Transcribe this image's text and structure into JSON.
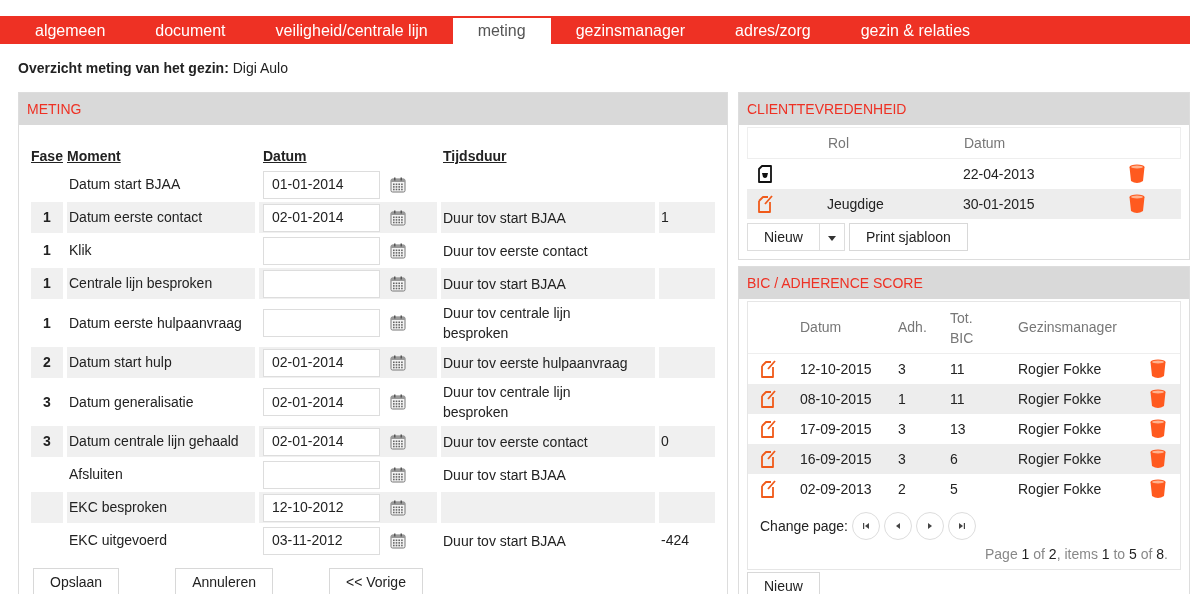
{
  "tabs": [
    {
      "label": "algemeen",
      "selected": false
    },
    {
      "label": "document",
      "selected": false
    },
    {
      "label": "veiligheid/centrale lijn",
      "selected": false
    },
    {
      "label": "meting",
      "selected": true
    },
    {
      "label": "gezinsmanager",
      "selected": false
    },
    {
      "label": "adres/zorg",
      "selected": false
    },
    {
      "label": "gezin & relaties",
      "selected": false
    }
  ],
  "heading": "**Overzicht meting van het gezin:** Digi Aulo",
  "meting": {
    "title": "METING",
    "columns": [
      "Fase",
      "Moment",
      "Datum",
      "Tijdsduur"
    ],
    "rows": [
      {
        "moment": "Datum start BJAA",
        "datum": "01-01-2014"
      },
      {
        "fase": "1",
        "moment": "Datum eerste contact",
        "datum": "02-01-2014",
        "tijdsduur": "Duur tov start BJAA",
        "waarde": "1"
      },
      {
        "fase": "1",
        "moment": "Klik",
        "tijdsduur": "Duur tov eerste contact"
      },
      {
        "fase": "1",
        "moment": "Centrale lijn besproken",
        "tijdsduur": "Duur tov start BJAA"
      },
      {
        "fase": "1",
        "moment": "Datum eerste hulpaanvraag",
        "tijdsduur": "Duur tov centrale lijn besproken"
      },
      {
        "fase": "2",
        "moment": "Datum start hulp",
        "datum": "02-01-2014",
        "tijdsduur": "Duur tov eerste hulpaanvraag"
      },
      {
        "fase": "3",
        "moment": "Datum generalisatie",
        "datum": "02-01-2014",
        "tijdsduur": "Duur tov centrale lijn besproken"
      },
      {
        "fase": "3",
        "moment": "Datum centrale lijn gehaald",
        "datum": "02-01-2014",
        "tijdsduur": "Duur tov eerste contact",
        "waarde": "0"
      },
      {
        "moment": "Afsluiten",
        "tijdsduur": "Duur tov start BJAA"
      },
      {
        "moment": "EKC besproken",
        "datum": "12-10-2012"
      },
      {
        "moment": "EKC uitgevoerd",
        "datum": "03-11-2012",
        "tijdsduur": "Duur tov start BJAA",
        "waarde": "-424"
      }
    ],
    "buttons": [
      "Opslaan",
      "Annuleren",
      "<< Vorige"
    ]
  },
  "clienttevredenheid": {
    "title": "CLIENTTEVREDENHEID",
    "columns": [
      "Rol",
      "Datum"
    ],
    "rows": [
      {
        "kind": "document",
        "datum": "22-04-2013"
      },
      {
        "kind": "edit",
        "rol": "Jeugdige",
        "datum": "30-01-2015"
      }
    ],
    "new_button": "Nieuw",
    "print_button": "Print sjabloon"
  },
  "bic": {
    "title": "BIC / ADHERENCE SCORE",
    "columns": [
      "Datum",
      "Adh.",
      "Tot. BIC",
      "Gezinsmanager"
    ],
    "rows": [
      {
        "datum": "12-10-2015",
        "adh": "3",
        "tot_bic": "11",
        "gezinsmanager": "Rogier Fokke"
      },
      {
        "datum": "08-10-2015",
        "adh": "1",
        "tot_bic": "11",
        "gezinsmanager": "Rogier Fokke"
      },
      {
        "datum": "17-09-2015",
        "adh": "3",
        "tot_bic": "13",
        "gezinsmanager": "Rogier Fokke"
      },
      {
        "datum": "16-09-2015",
        "adh": "3",
        "tot_bic": "6",
        "gezinsmanager": "Rogier Fokke"
      },
      {
        "datum": "02-09-2013",
        "adh": "2",
        "tot_bic": "5",
        "gezinsmanager": "Rogier Fokke"
      }
    ],
    "pager_label": "Change page:",
    "pager_info": "Page **1** of **2**, items **1** to **5** of **8**.",
    "new_button": "Nieuw"
  }
}
